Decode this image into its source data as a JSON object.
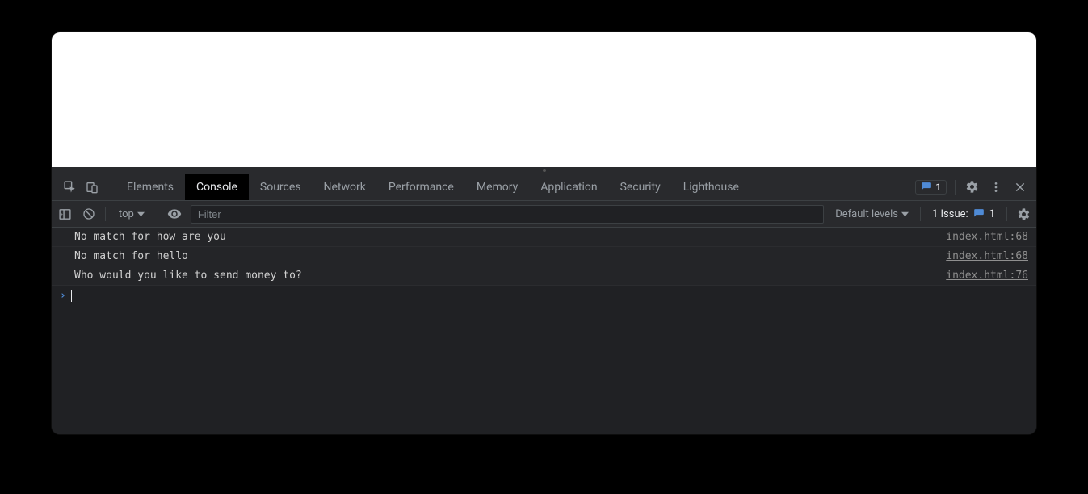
{
  "tabs": {
    "elements": "Elements",
    "console": "Console",
    "sources": "Sources",
    "network": "Network",
    "performance": "Performance",
    "memory": "Memory",
    "application": "Application",
    "security": "Security",
    "lighthouse": "Lighthouse"
  },
  "top_issue_count": "1",
  "toolbar": {
    "context": "top",
    "filter_placeholder": "Filter",
    "levels_label": "Default levels",
    "issues_label": "1 Issue:",
    "issues_count": "1"
  },
  "logs": [
    {
      "msg": "No match for how are you",
      "src": "index.html:68"
    },
    {
      "msg": "No match for hello",
      "src": "index.html:68"
    },
    {
      "msg": "Who would you like to send money to?",
      "src": "index.html:76"
    }
  ]
}
